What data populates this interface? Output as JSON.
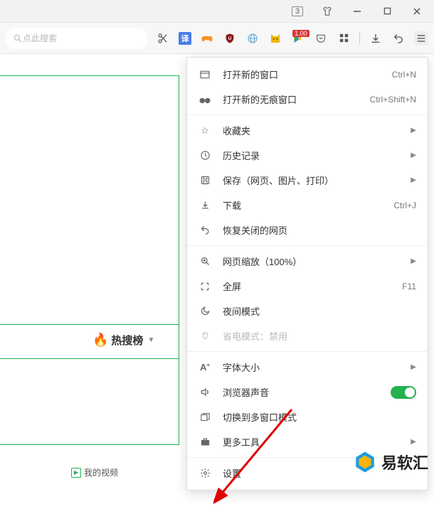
{
  "titlebar": {
    "tab_count": "3"
  },
  "search": {
    "placeholder": "点此搜索"
  },
  "toolbar": {
    "translate_badge": "译",
    "badge_text": "1.00"
  },
  "hot_label": "热搜榜",
  "menu": {
    "new_window": {
      "label": "打开新的窗口",
      "shortcut": "Ctrl+N"
    },
    "new_private": {
      "label": "打开新的无痕窗口",
      "shortcut": "Ctrl+Shift+N"
    },
    "favorites": {
      "label": "收藏夹"
    },
    "history": {
      "label": "历史记录"
    },
    "save": {
      "label": "保存（网页、图片、打印）"
    },
    "downloads": {
      "label": "下载",
      "shortcut": "Ctrl+J"
    },
    "reopen": {
      "label": "恢复关闭的网页"
    },
    "zoom": {
      "label": "网页缩放（100%）"
    },
    "fullscreen": {
      "label": "全屏",
      "shortcut": "F11"
    },
    "night": {
      "label": "夜间模式"
    },
    "power_save": {
      "label": "省电模式：禁用"
    },
    "font_size": {
      "label": "字体大小"
    },
    "sound": {
      "label": "浏览器声音"
    },
    "multi_window": {
      "label": "切换到多窗口模式"
    },
    "more_tools": {
      "label": "更多工具"
    },
    "settings": {
      "label": "设置"
    }
  },
  "myvideo": "我的视频",
  "watermark": "易软汇"
}
